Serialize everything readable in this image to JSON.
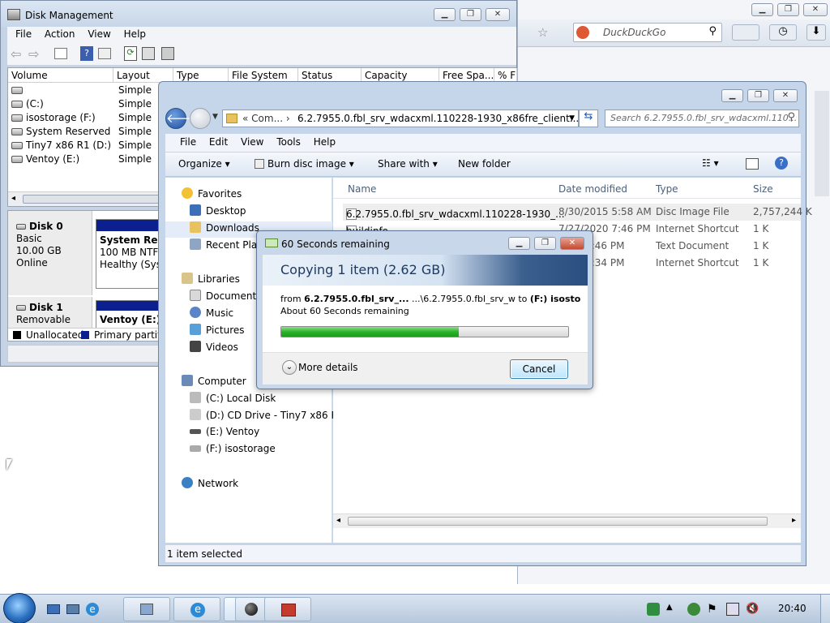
{
  "browser": {
    "search_placeholder": "DuckDuckGo"
  },
  "disk_mgmt": {
    "title": "Disk Management",
    "menu": [
      "File",
      "Action",
      "View",
      "Help"
    ],
    "columns": [
      "Volume",
      "Layout",
      "Type",
      "File System",
      "Status",
      "Capacity",
      "Free Spa...",
      "% F"
    ],
    "volumes": [
      {
        "name": "",
        "layout": "Simple"
      },
      {
        "name": "(C:)",
        "layout": "Simple"
      },
      {
        "name": "isostorage (F:)",
        "layout": "Simple"
      },
      {
        "name": "System Reserved",
        "layout": "Simple"
      },
      {
        "name": "Tiny7 x86 R1 (D:)",
        "layout": "Simple"
      },
      {
        "name": "Ventoy (E:)",
        "layout": "Simple"
      }
    ],
    "disk0": {
      "name": "Disk 0",
      "type": "Basic",
      "size": "10.00 GB",
      "state": "Online",
      "part_name": "System Reser",
      "part_size": "100 MB NTFS",
      "part_status": "Healthy (Syste"
    },
    "disk1": {
      "name": "Disk 1",
      "type": "Removable",
      "part_name": "Ventoy (E:)"
    },
    "legend": {
      "unallocated": "Unallocated",
      "primary": "Primary partitio"
    }
  },
  "explorer": {
    "address": "6.2.7955.0.fbl_srv_wdacxml.110228-1930_x86fre_client...",
    "address_prefix": "«  Com...  ›",
    "search_placeholder": "Search 6.2.7955.0.fbl_srv_wdacxml.110...",
    "menu": [
      "File",
      "Edit",
      "View",
      "Tools",
      "Help"
    ],
    "toolbar": {
      "organize": "Organize",
      "burn": "Burn disc image",
      "share": "Share with",
      "new_folder": "New folder"
    },
    "nav": {
      "favorites": "Favorites",
      "desktop": "Desktop",
      "downloads": "Downloads",
      "recent": "Recent Plac",
      "libraries": "Libraries",
      "documents": "Documents",
      "music": "Music",
      "pictures": "Pictures",
      "videos": "Videos",
      "computer": "Computer",
      "c_drive": "(C:) Local Disk",
      "d_drive": "(D:) CD Drive - Tiny7 x86 R1",
      "e_drive": "(E:) Ventoy",
      "f_drive": "(F:) isostorage",
      "network": "Network"
    },
    "columns": {
      "name": "Name",
      "date": "Date modified",
      "type": "Type",
      "size": "Size"
    },
    "files": [
      {
        "name": "6.2.7955.0.fbl_srv_wdacxml.110228-1930_...",
        "date": "8/30/2015 5:58 AM",
        "type": "Disc Image File",
        "size": "2,757,244 K"
      },
      {
        "name": "buildinfo",
        "date": "7/27/2020 7:46 PM",
        "type": "Internet Shortcut",
        "size": "1 K"
      },
      {
        "name": "",
        "date": "20 7:46 PM",
        "type": "Text Document",
        "size": "1 K"
      },
      {
        "name": "",
        "date": "20 7:34 PM",
        "type": "Internet Shortcut",
        "size": "1 K"
      }
    ],
    "status": "1 item selected"
  },
  "copy_dialog": {
    "title": "60 Seconds remaining",
    "heading": "Copying 1 item (2.62 GB)",
    "from_label": "from",
    "from_value": "6.2.7955.0.fbl_srv_...",
    "from_path": "...\\6.2.7955.0.fbl_srv_w",
    "to_label": "to",
    "to_value": "(F:) isostorage",
    "remaining": "About 60 Seconds remaining",
    "progress": 0.62,
    "more_details": "More details",
    "cancel": "Cancel"
  },
  "taskbar": {
    "clock": "20:40"
  }
}
